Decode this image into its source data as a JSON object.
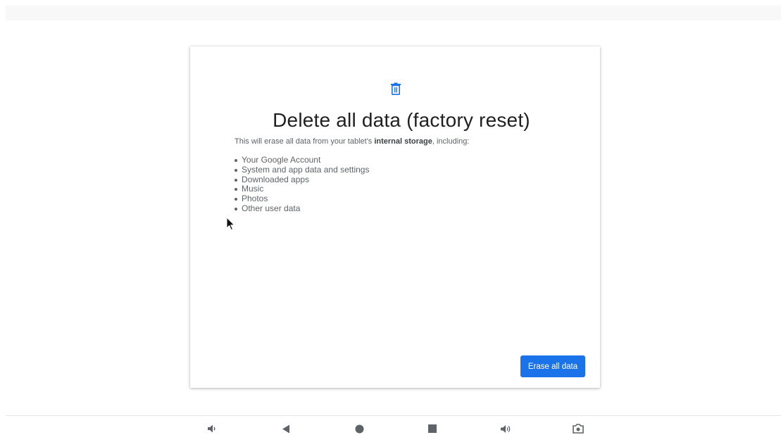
{
  "dialog": {
    "icon": "trash-icon",
    "title": "Delete all data (factory reset)",
    "description_prefix": "This will erase all data from your tablet's ",
    "description_bold": "internal storage",
    "description_suffix": ", including:",
    "items": [
      "Your Google Account",
      "System and app data and settings",
      "Downloaded apps",
      "Music",
      "Photos",
      "Other user data"
    ],
    "erase_button_label": "Erase all data"
  },
  "navbar": {
    "buttons": [
      "volume-down-icon",
      "back-icon",
      "home-icon",
      "recents-icon",
      "volume-up-icon",
      "screenshot-icon"
    ]
  },
  "colors": {
    "accent": "#1a73e8",
    "title_text": "#212121",
    "body_text": "#5f6368",
    "nav_icon": "#5f6368"
  }
}
